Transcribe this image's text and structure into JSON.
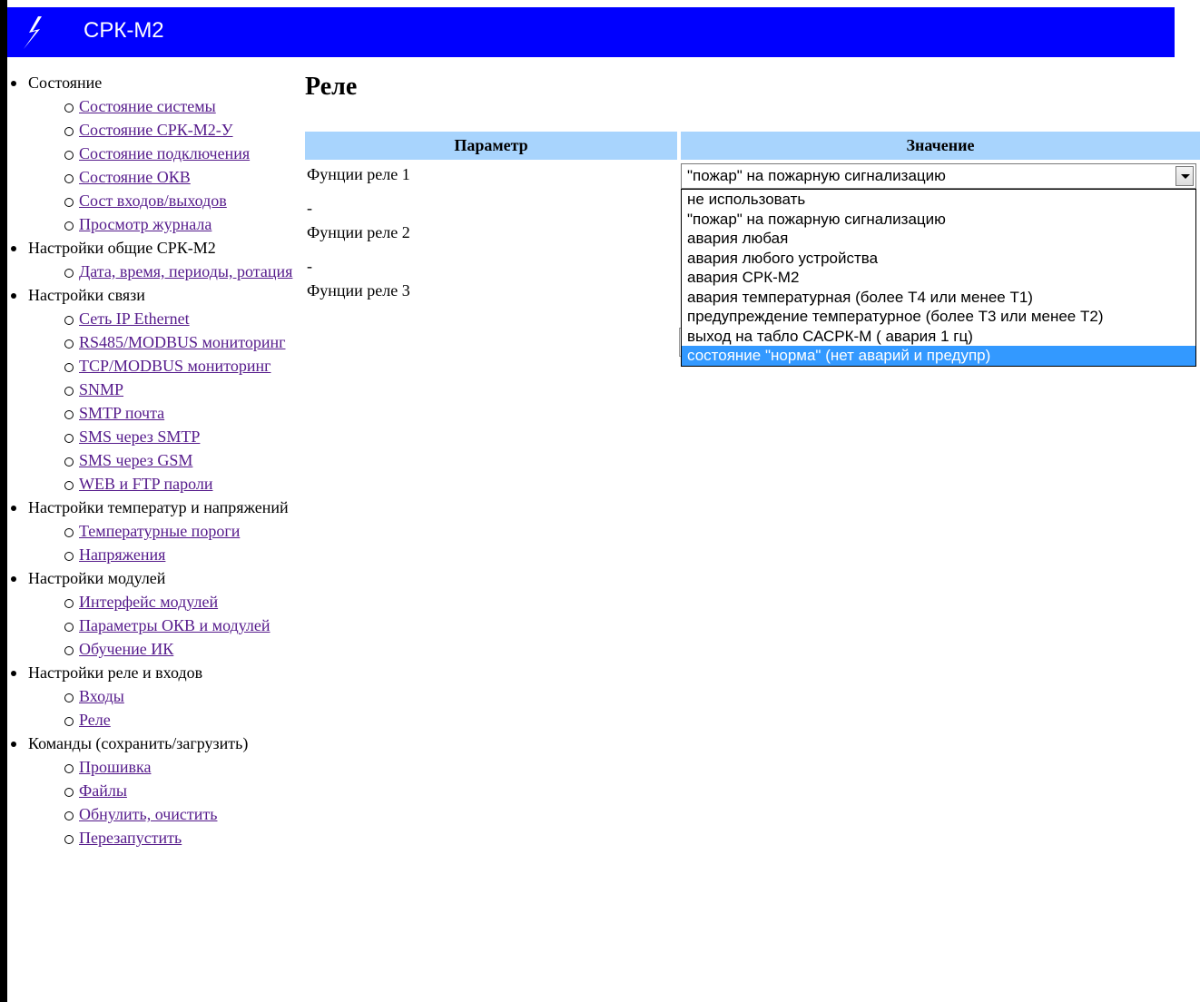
{
  "header": {
    "title": "СРК-М2",
    "logo": "lightning-logo"
  },
  "sidebar": {
    "groups": [
      {
        "label": "Состояние",
        "items": [
          "Состояние системы",
          "Состояние СРК-М2-У",
          "Состояние подключения",
          "Состояние ОКВ",
          "Сост входов/выходов",
          "Просмотр журнала"
        ]
      },
      {
        "label": "Настройки общие СРК-М2",
        "items": [
          "Дата, время, периоды, ротация"
        ]
      },
      {
        "label": "Настройки связи",
        "items": [
          "Сеть IP Ethernet",
          "RS485/MODBUS мониторинг",
          "TCP/MODBUS мониторинг",
          "SNMP",
          "SMTP почта",
          "SMS через SMTP",
          "SMS через GSM",
          "WEB и FTP пароли"
        ]
      },
      {
        "label": "Настройки температур и напряжений",
        "items": [
          "Температурные пороги",
          "Напряжения"
        ]
      },
      {
        "label": "Настройки модулей",
        "items": [
          "Интерфейс модулей",
          "Параметры ОКВ и модулей",
          "Обучение ИК"
        ]
      },
      {
        "label": "Настройки реле и входов",
        "items": [
          "Входы",
          "Реле"
        ]
      },
      {
        "label": "Команды (сохранить/загрузить)",
        "items": [
          "Прошивка",
          "Файлы",
          "Обнулить, очистить",
          "Перезапустить"
        ]
      }
    ]
  },
  "main": {
    "title": "Реле",
    "table": {
      "headers": [
        "Параметр",
        "Значение"
      ],
      "rows": [
        {
          "label": "Фунции реле 1",
          "value": "\"пожар\" на пожарную сигнализацию"
        },
        {
          "label": "Фунции реле 2"
        },
        {
          "label": "Фунции реле 3"
        }
      ],
      "separator": "-"
    },
    "dropdown": {
      "options": [
        "не использовать",
        "\"пожар\" на пожарную сигнализацию",
        "авария любая",
        "авария любого устройства",
        "авария СРК-М2",
        "авария температурная (более Т4 или менее Т1)",
        "предупреждение температурное (более Т3 или менее Т2)",
        "выход на табло САСРК-М ( авария 1 гц)",
        "состояние \"норма\" (нет аварий и предупр)"
      ],
      "highlighted_index": 8
    }
  },
  "colors": {
    "header_bg": "#0000ff",
    "table_header_bg": "#a8d4fd",
    "link": "#551a8b",
    "highlight": "#3399ff"
  }
}
